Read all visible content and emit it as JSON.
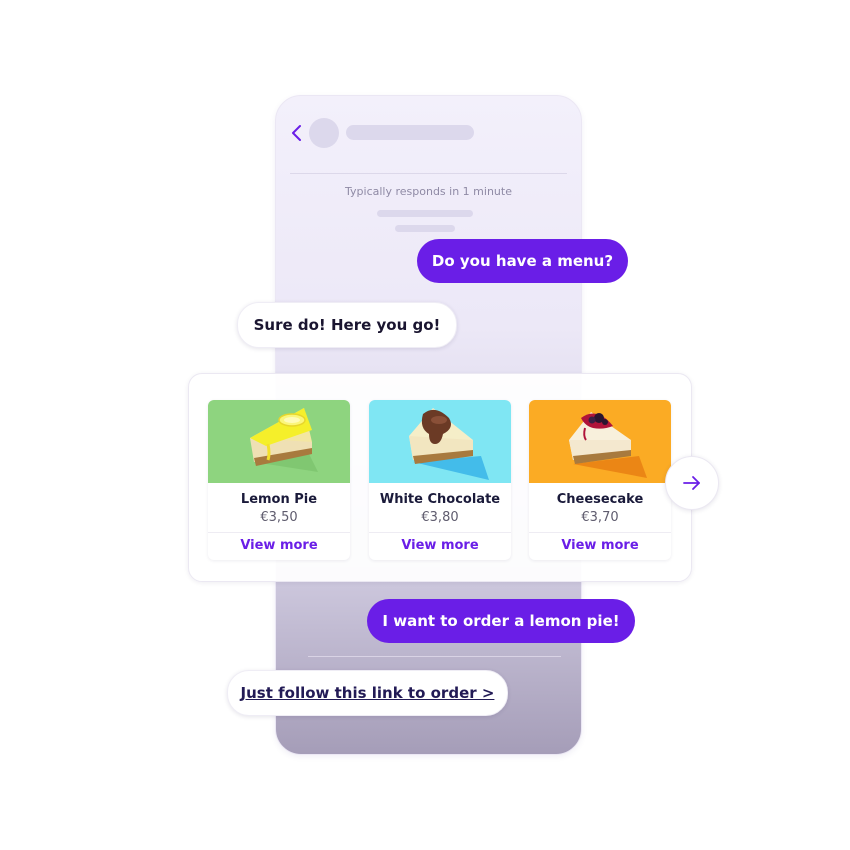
{
  "header": {
    "status_text": "Typically responds in 1 minute",
    "back_icon": "chevron-left-icon"
  },
  "messages": [
    {
      "from": "user",
      "text": "Do you have a menu?"
    },
    {
      "from": "bot",
      "text": "Sure do! Here you go!"
    },
    {
      "from": "user",
      "text": "I want to order a lemon pie!"
    },
    {
      "from": "bot",
      "text": "Just follow this link to order >"
    }
  ],
  "products": [
    {
      "name": "Lemon Pie",
      "price": "€3,50",
      "link": "View more",
      "bg_color": "#8ed47f"
    },
    {
      "name": "White Chocolate",
      "price": "€3,80",
      "link": "View more",
      "bg_color": "#7fe6f3"
    },
    {
      "name": "Cheesecake",
      "price": "€3,70",
      "link": "View more",
      "bg_color": "#fbab24"
    }
  ],
  "carousel": {
    "next_icon": "arrow-right-icon"
  },
  "colors": {
    "accent": "#6a1ee7",
    "link": "#221a55"
  }
}
